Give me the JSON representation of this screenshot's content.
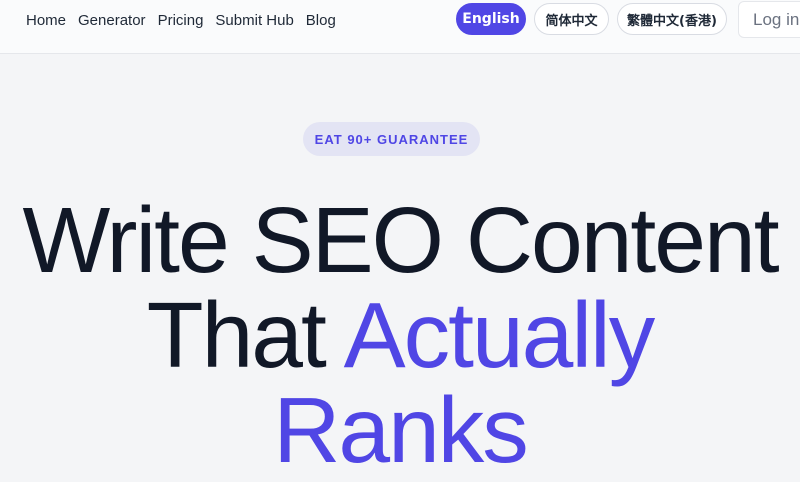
{
  "nav": {
    "links": [
      "Home",
      "Generator",
      "Pricing",
      "Submit Hub",
      "Blog"
    ],
    "languages": {
      "active": "English",
      "simplified": "简体中文",
      "traditional": "繁體中文(香港)"
    },
    "login": "Log in"
  },
  "hero": {
    "badge": "EAT 90+ GUARANTEE",
    "line1": "Write SEO Content",
    "line2_plain": "That",
    "line2_accent": "Actually",
    "line3": "Ranks"
  },
  "colors": {
    "accent": "#5046e5",
    "badge_bg": "#e3e4f4",
    "background": "#f4f5f7"
  }
}
